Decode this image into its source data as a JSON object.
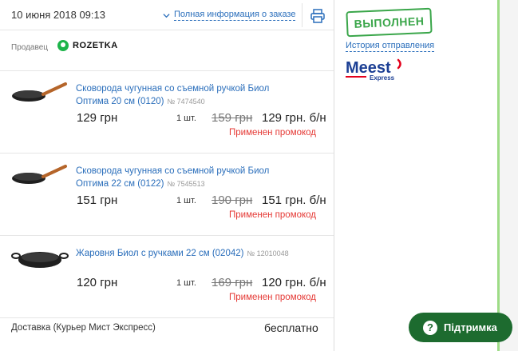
{
  "header": {
    "order_date": "10 июня 2018 09:13",
    "details_link": "Полная информация о заказе",
    "print_icon": "printer-icon"
  },
  "seller": {
    "label": "Продавец",
    "name": "ROZETKA"
  },
  "items": [
    {
      "title": "Сковорода чугунная со съемной ручкой Биол Оптима 20 см (0120)",
      "sku": "№ 7474540",
      "price": "129 грн",
      "qty": "1 шт.",
      "old_price": "159 грн",
      "new_price": "129 грн. б/н",
      "promo": "Применен промокод",
      "image": "skillet-with-wooden-handle"
    },
    {
      "title": "Сковорода чугунная со съемной ручкой Биол Оптима 22 см (0122)",
      "sku": "№ 7545513",
      "price": "151 грн",
      "qty": "1 шт.",
      "old_price": "190 грн",
      "new_price": "151 грн. б/н",
      "promo": "Применен промокод",
      "image": "skillet-with-wooden-handle"
    },
    {
      "title": "Жаровня Биол с ручками 22 см (02042)",
      "sku": "№ 12010048",
      "price": "120 грн",
      "qty": "1 шт.",
      "old_price": "169 грн",
      "new_price": "120 грн. б/н",
      "promo": "Применен промокод",
      "image": "braising-pan-with-handles"
    }
  ],
  "delivery": {
    "label": "Доставка (Курьер Мист Экспресс)",
    "value": "бесплатно"
  },
  "status": {
    "stamp": "ВЫПОЛНЕН",
    "history_link": "История отправления",
    "carrier_logo_main": "Meest",
    "carrier_logo_sub": "Express"
  },
  "support": {
    "label": "Підтримка"
  },
  "colors": {
    "link": "#2a6ebb",
    "promo": "#e53935",
    "stamp": "#3aa64a",
    "support_bg": "#1d6b2f",
    "rail": "#9ddc86",
    "meest_blue": "#1c3f94",
    "meest_red": "#e3001b"
  }
}
